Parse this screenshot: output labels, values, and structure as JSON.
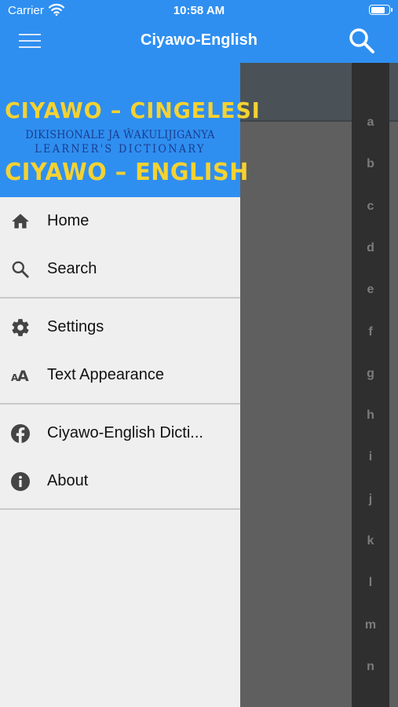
{
  "status_bar": {
    "carrier": "Carrier",
    "time": "10:58 AM",
    "battery_level": 0.85
  },
  "nav": {
    "title": "Ciyawo-English",
    "menu_icon": "hamburger-icon",
    "search_icon": "search-icon"
  },
  "banner": {
    "line1": "CIYAWO – CINGELESI",
    "line2": "DIKISHONALE JA ŴAKULIJIGANYA",
    "line3": "LEARNER'S DICTIONARY",
    "line4": "CIYAWO – ENGLISH"
  },
  "menu": {
    "home": "Home",
    "search": "Search",
    "settings": "Settings",
    "text_appearance": "Text Appearance",
    "facebook": "Ciyawo-English Dicti...",
    "about": "About"
  },
  "alphabet": [
    "a",
    "b",
    "c",
    "d",
    "e",
    "f",
    "g",
    "h",
    "i",
    "j",
    "k",
    "l",
    "m",
    "n"
  ],
  "colors": {
    "accent": "#2f8ff0",
    "banner_yellow": "#f4d232",
    "banner_blue": "#1a3d8f",
    "drawer_bg": "#efefef"
  }
}
